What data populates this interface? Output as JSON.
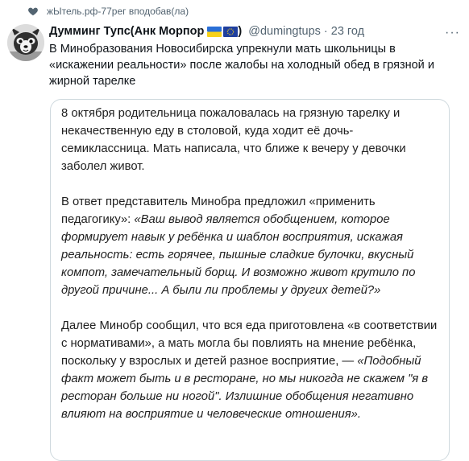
{
  "retweet": {
    "text": "жЫтель.рф-77рег вподобав(ла)",
    "icon": "heart-icon"
  },
  "author": {
    "display_name": "Думминг Тупс(Анк Морпор",
    "handle": "@dumingtups",
    "time": "23 год"
  },
  "tweet": {
    "text": "В Минобразования Новосибирска упрекнули мать школьницы в «искажении реальности» после жалобы на холодный обед в грязной и жирной тарелке"
  },
  "quote": {
    "p1": "8 октября родительница пожаловалась на грязную тарелку и некачественную еду в столовой, куда ходит её дочь-семиклассница. Мать написала, что ближе к вечеру у девочки заболел живот.",
    "p2_intro": "В ответ представитель Минобра предложил «применить педагогику»: ",
    "p2_quote": "«Ваш вывод является обобщением, которое формирует навык у ребёнка и шаблон восприятия, искажая реальность: есть горячее, пышные сладкие булочки, вкусный компот, замечательный борщ. И возможно живот крутило по другой причине... А были ли проблемы у других детей?»",
    "p3_intro": "Далее Минобр сообщил, что вся еда приготовлена «в соответствии с нормативами», а мать могла бы повлиять на мнение ребёнка, поскольку у взрослых и детей разное восприятие, — ",
    "p3_quote": "«Подобный факт может быть и в ресторане, но мы никогда не скажем \"я в ресторан больше ни ногой\". Излишние обобщения негативно влияют на восприятие и человеческие отношения»."
  }
}
